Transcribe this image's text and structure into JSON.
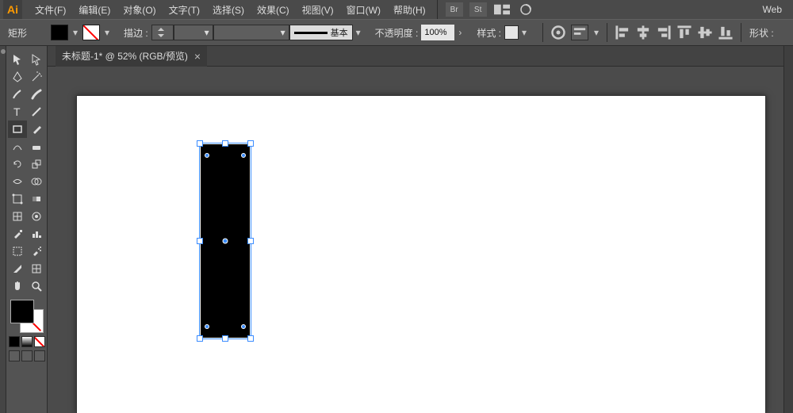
{
  "app": {
    "logo": "Ai"
  },
  "menu": {
    "items": [
      "文件(F)",
      "编辑(E)",
      "对象(O)",
      "文字(T)",
      "选择(S)",
      "效果(C)",
      "视图(V)",
      "窗口(W)",
      "帮助(H)"
    ],
    "right": {
      "bridge": "Br",
      "stock": "St",
      "web": "Web"
    }
  },
  "control": {
    "context_label": "矩形",
    "fill_color": "#000000",
    "stroke_label": "描边 :",
    "stroke_profile_label": "基本",
    "opacity_label": "不透明度 :",
    "opacity_value": "100%",
    "style_label": "样式 :",
    "shape_label": "形状 :"
  },
  "tab": {
    "title": "未标题-1* @ 52% (RGB/预览)",
    "close": "×"
  },
  "tools_left": [
    "selection",
    "pen",
    "brush",
    "type",
    "rectangle",
    "curvature",
    "rotate",
    "width",
    "freeform",
    "mesh",
    "eyedropper",
    "artboard",
    "slice",
    "hand"
  ],
  "tools_right": [
    "direct-selection",
    "magic-wand",
    "blob-brush",
    "line",
    "paintbrush",
    "eraser",
    "scale",
    "shape-builder",
    "gradient",
    "liquify",
    "column-graph",
    "symbol-sprayer",
    "slice-select",
    "zoom"
  ],
  "mini_swatches": [
    "#000000",
    "#808080",
    "nostroke"
  ],
  "screen_modes": [
    "normal",
    "full"
  ]
}
